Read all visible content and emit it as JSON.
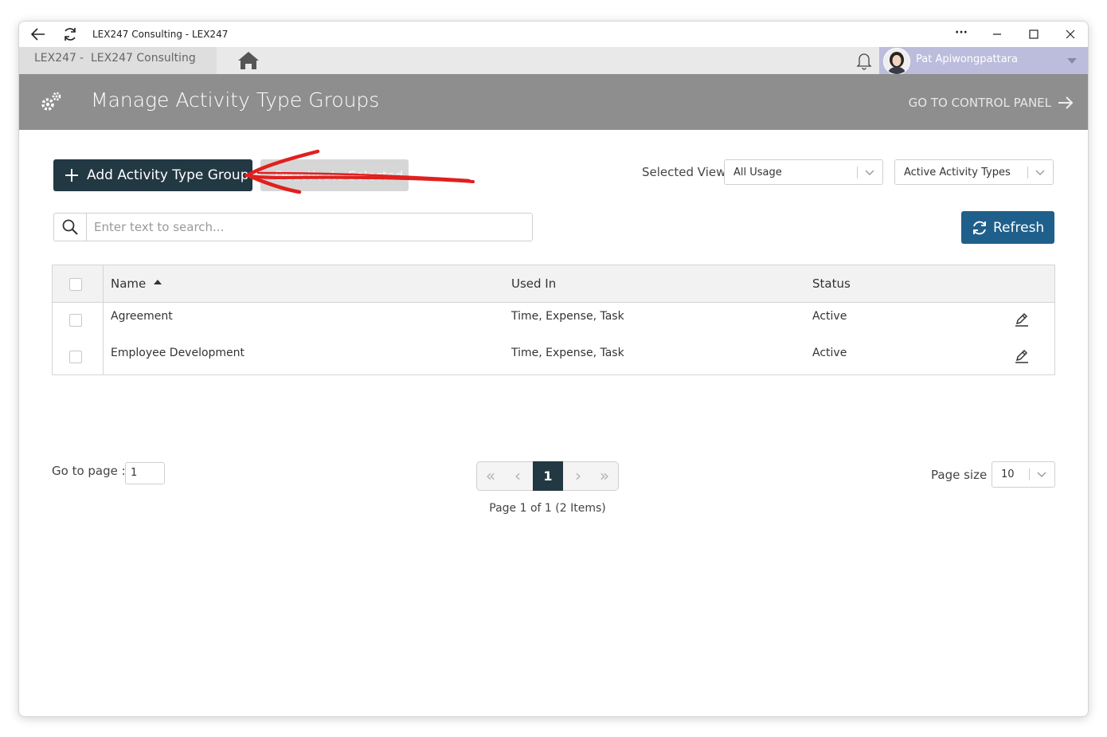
{
  "browser": {
    "title": "LEX247 Consulting - LEX247",
    "more_label": "···"
  },
  "nav": {
    "org_short": "LEX247",
    "separator": "-",
    "org_name": "LEX247 Consulting",
    "user_name": "Pat Apiwongpattara"
  },
  "header": {
    "title": "Manage Activity Type Groups",
    "control_panel_link": "GO TO CONTROL PANEL"
  },
  "toolbar": {
    "add_label": "Add Activity Type Group",
    "deactivate_label": "Deactivate Selected",
    "selected_view_label": "Selected View",
    "usage_filter": "All Usage",
    "status_filter": "Active Activity Types",
    "search_placeholder": "Enter text to search...",
    "refresh_label": "Refresh"
  },
  "grid": {
    "columns": [
      "Name",
      "Used In",
      "Status"
    ],
    "sort_column": "Name",
    "sort_direction": "ascending",
    "rows": [
      {
        "name": "Agreement",
        "used_in": "Time, Expense, Task",
        "status": "Active"
      },
      {
        "name": "Employee Development",
        "used_in": "Time, Expense, Task",
        "status": "Active"
      }
    ]
  },
  "pagination": {
    "goto_label": "Go to page :",
    "goto_value": "1",
    "current_page": "1",
    "info": "Page 1 of 1 (2 Items)",
    "page_size_label": "Page size :",
    "page_size": "10"
  },
  "colors": {
    "primary_dark": "#223843",
    "refresh_blue": "#1f5f8b",
    "header_gray": "#8e8e8e",
    "user_bar": "#bcbcdc",
    "annotation_red": "#e0201e"
  },
  "icons": {
    "back": "back-arrow-icon",
    "reload": "reload-icon",
    "home": "home-icon",
    "bell": "bell-icon",
    "header": "gears-icon",
    "search": "search-icon",
    "refresh": "refresh-icon",
    "edit": "pencil-icon"
  }
}
